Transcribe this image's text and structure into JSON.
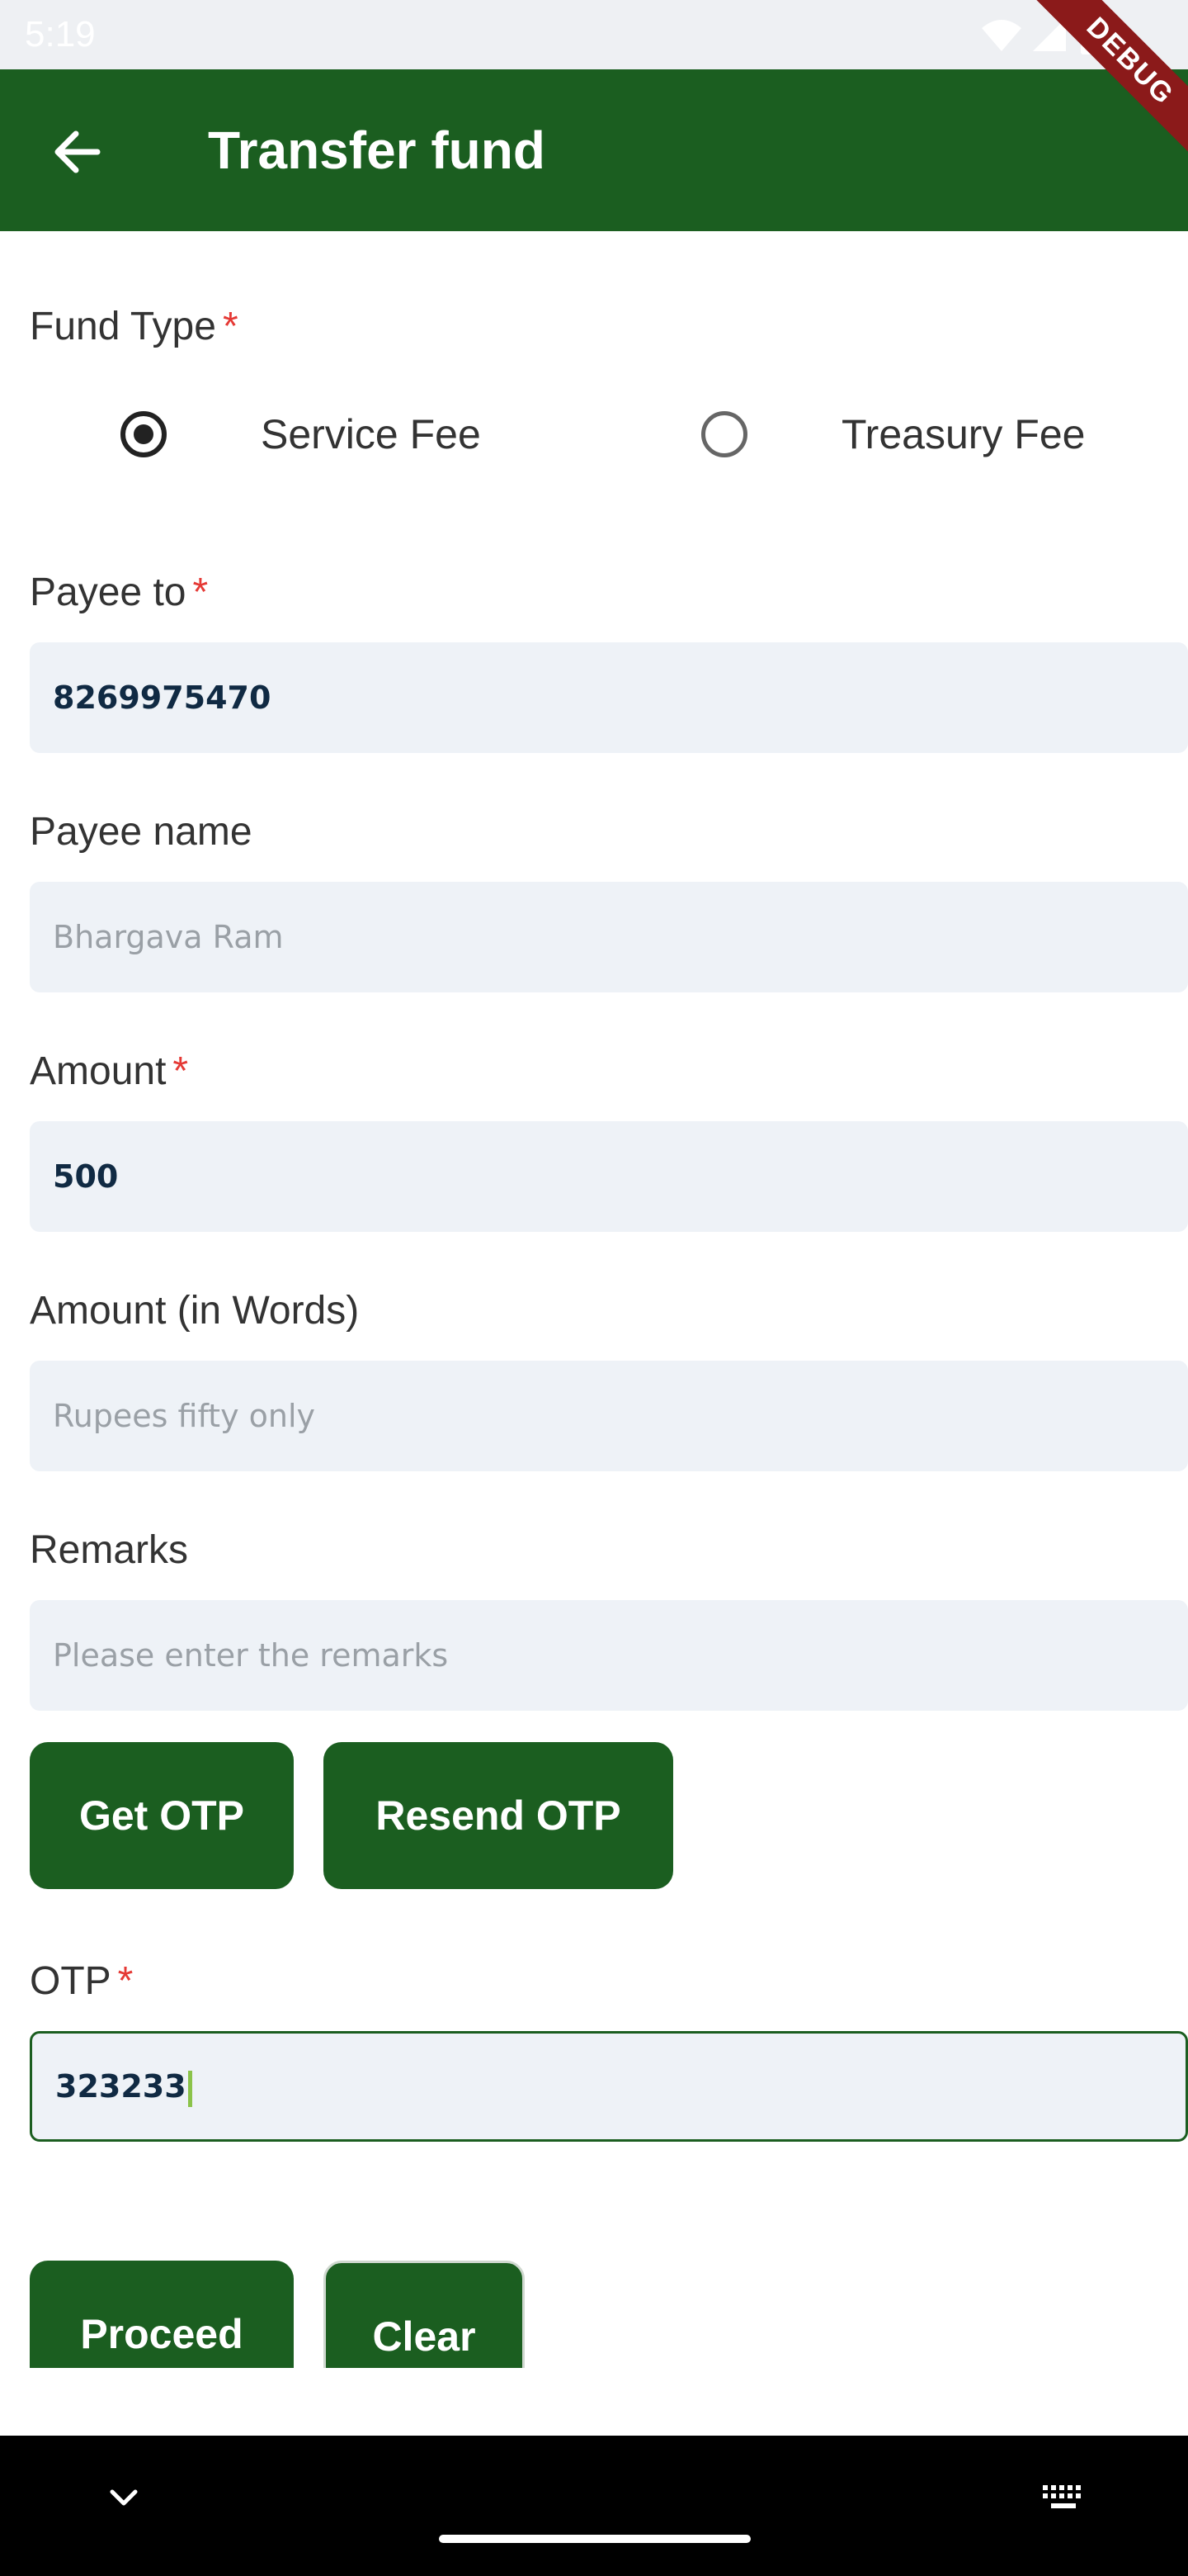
{
  "status_bar": {
    "time": "5:19",
    "icons": [
      "wifi-icon",
      "signal-icon",
      "battery-icon"
    ]
  },
  "debug_banner": "DEBUG",
  "app_bar": {
    "title": "Transfer fund",
    "back_icon": "arrow-left-icon"
  },
  "form": {
    "fund_type": {
      "label": "Fund Type",
      "required_mark": "*",
      "options": [
        {
          "label": "Service Fee",
          "selected": true
        },
        {
          "label": "Treasury Fee",
          "selected": false
        }
      ]
    },
    "payee_to": {
      "label": "Payee to",
      "required_mark": "*",
      "value": "8269975470"
    },
    "payee_name": {
      "label": "Payee name",
      "placeholder": "Bhargava Ram"
    },
    "amount": {
      "label": "Amount",
      "required_mark": "*",
      "value": "500"
    },
    "amount_words": {
      "label": "Amount (in Words)",
      "placeholder": "Rupees fifty only"
    },
    "remarks": {
      "label": "Remarks",
      "placeholder": "Please enter the remarks"
    },
    "get_otp_label": "Get OTP",
    "resend_otp_label": "Resend OTP",
    "otp": {
      "label": "OTP",
      "required_mark": "*",
      "value": "323233"
    },
    "proceed_label": "Proceed",
    "clear_label": "Clear"
  },
  "colors": {
    "primary": "#1b5e20",
    "required": "#e53935",
    "field_bg": "#eef2f7",
    "cursor": "#8bc34a"
  },
  "nav_bar": {
    "icons": [
      "chevron-down-icon",
      "home-pill-icon",
      "keyboard-icon"
    ]
  }
}
